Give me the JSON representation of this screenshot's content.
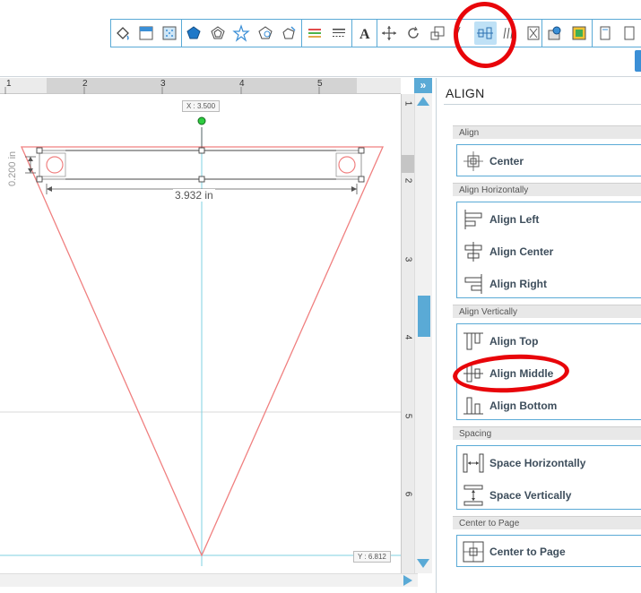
{
  "canvas": {
    "ruler_top_labels": [
      "1",
      "2",
      "3",
      "4",
      "5"
    ],
    "ruler_side_labels": [
      "1",
      "2",
      "3",
      "4",
      "5",
      "6"
    ],
    "x_readout": "X : 3.500",
    "y_readout": "Y : 6.812",
    "width_dimension": "3.932 in",
    "height_dimension": "0.200 in"
  },
  "panel": {
    "title": "ALIGN",
    "sections": [
      {
        "header": "Align",
        "items": [
          {
            "label": "Center",
            "icon": "align-center-icon"
          }
        ]
      },
      {
        "header": "Align Horizontally",
        "items": [
          {
            "label": "Align Left",
            "icon": "align-left-icon"
          },
          {
            "label": "Align Center",
            "icon": "align-center-horizontal-icon"
          },
          {
            "label": "Align Right",
            "icon": "align-right-icon"
          }
        ]
      },
      {
        "header": "Align Vertically",
        "items": [
          {
            "label": "Align Top",
            "icon": "align-top-icon"
          },
          {
            "label": "Align Middle",
            "icon": "align-middle-icon"
          },
          {
            "label": "Align Bottom",
            "icon": "align-bottom-icon"
          }
        ]
      },
      {
        "header": "Spacing",
        "items": [
          {
            "label": "Space Horizontally",
            "icon": "space-horizontally-icon"
          },
          {
            "label": "Space Vertically",
            "icon": "space-vertically-icon"
          }
        ]
      },
      {
        "header": "Center to Page",
        "items": [
          {
            "label": "Center to Page",
            "icon": "center-to-page-icon"
          }
        ]
      }
    ]
  },
  "colors": {
    "accent": "#5aaad6",
    "highlight": "#e8050a",
    "shape_stroke": "#f08080",
    "guide": "#7fd0e0"
  }
}
